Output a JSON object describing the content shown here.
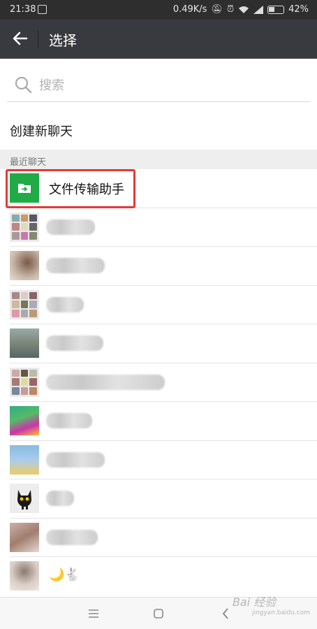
{
  "status_bar": {
    "time": "21:38",
    "speed": "0.49K/s",
    "battery": "42%"
  },
  "header": {
    "title": "选择"
  },
  "search": {
    "placeholder": "搜索"
  },
  "new_chat": {
    "label": "创建新聊天"
  },
  "recent": {
    "section_label": "最近聊天",
    "pinned_name": "文件传输助手",
    "emoji_name": "🌙🐇"
  },
  "colors": {
    "title_bar": "#393a3f",
    "file_helper_green": "#20ab46",
    "highlight_red": "#e53935"
  },
  "watermark": {
    "brand": "Bai 经验",
    "domain": "jingyan.baidu.com"
  }
}
